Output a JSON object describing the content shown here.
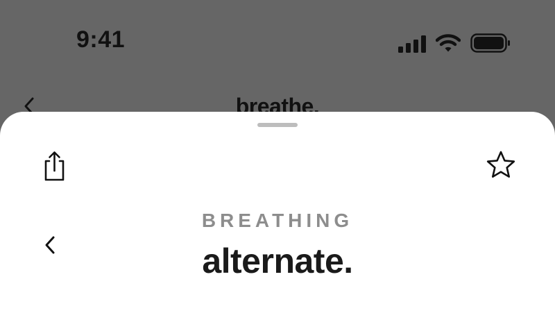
{
  "status_bar": {
    "time": "9:41",
    "icons": [
      "cellular-signal-icon",
      "wifi-icon",
      "battery-icon"
    ]
  },
  "background_screen": {
    "title": "breathe.",
    "back_icon": "chevron-left-icon"
  },
  "sheet": {
    "share_icon": "share-icon",
    "favorite_icon": "star-icon",
    "back_icon": "chevron-left-icon",
    "category": "BREATHING",
    "title": "alternate."
  },
  "colors": {
    "dimmed_background": "#666666",
    "sheet_background": "#ffffff",
    "category_text": "#8d8d8d",
    "title_text": "#1a1a1a",
    "grabber": "#bdbdbd"
  }
}
